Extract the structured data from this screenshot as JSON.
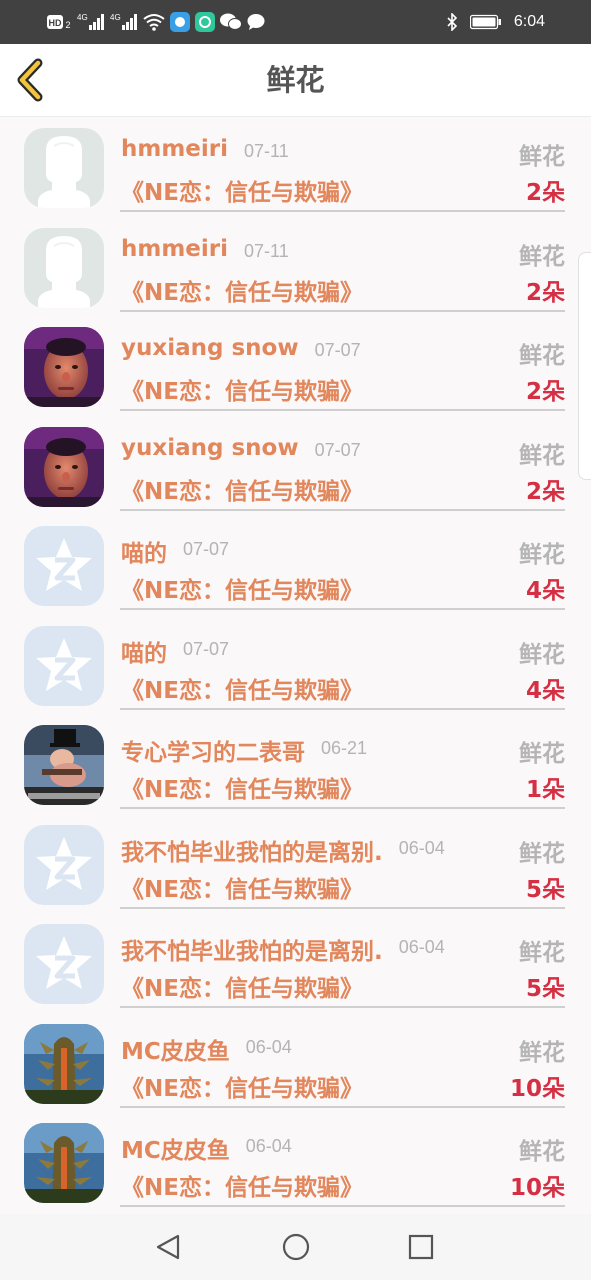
{
  "status_bar": {
    "time": "6:04",
    "left_icons": [
      "hd-icon",
      "signal-4g-icon",
      "signal-4g-icon",
      "wifi-icon",
      "app-icon",
      "app-icon",
      "wechat-icon",
      "chat-bubble-icon"
    ],
    "right_icons": [
      "bluetooth-icon",
      "battery-icon"
    ]
  },
  "header": {
    "title": "鲜花",
    "back_icon": "chevron-left-icon"
  },
  "rows": [
    {
      "name": "hmmeiri",
      "date": "07-11",
      "gift_label": "鲜花",
      "book": "《NE恋：信任与欺骗》",
      "count": "2朵",
      "avatar": "default-silhouette"
    },
    {
      "name": "hmmeiri",
      "date": "07-11",
      "gift_label": "鲜花",
      "book": "《NE恋：信任与欺骗》",
      "count": "2朵",
      "avatar": "default-silhouette"
    },
    {
      "name": "yuxiang snow",
      "date": "07-07",
      "gift_label": "鲜花",
      "book": "《NE恋：信任与欺骗》",
      "count": "2朵",
      "avatar": "face-photo"
    },
    {
      "name": "yuxiang snow",
      "date": "07-07",
      "gift_label": "鲜花",
      "book": "《NE恋：信任与欺骗》",
      "count": "2朵",
      "avatar": "face-photo"
    },
    {
      "name": "喵的",
      "date": "07-07",
      "gift_label": "鲜花",
      "book": "《NE恋：信任与欺骗》",
      "count": "4朵",
      "avatar": "qq-star"
    },
    {
      "name": "喵的",
      "date": "07-07",
      "gift_label": "鲜花",
      "book": "《NE恋：信任与欺骗》",
      "count": "4朵",
      "avatar": "qq-star"
    },
    {
      "name": "专心学习的二表哥",
      "date": "06-21",
      "gift_label": "鲜花",
      "book": "《NE恋：信任与欺骗》",
      "count": "1朵",
      "avatar": "cartoon-photo"
    },
    {
      "name": "我不怕毕业我怕的是离别.",
      "date": "06-04",
      "gift_label": "鲜花",
      "book": "《NE恋：信任与欺骗》",
      "count": "5朵",
      "avatar": "qq-star"
    },
    {
      "name": "我不怕毕业我怕的是离别.",
      "date": "06-04",
      "gift_label": "鲜花",
      "book": "《NE恋：信任与欺骗》",
      "count": "5朵",
      "avatar": "qq-star"
    },
    {
      "name": "MC皮皮鱼",
      "date": "06-04",
      "gift_label": "鲜花",
      "book": "《NE恋：信任与欺骗》",
      "count": "10朵",
      "avatar": "dragon-photo"
    },
    {
      "name": "MC皮皮鱼",
      "date": "06-04",
      "gift_label": "鲜花",
      "book": "《NE恋：信任与欺骗》",
      "count": "10朵",
      "avatar": "dragon-photo"
    }
  ],
  "nav_bar": {
    "icons": [
      "back-triangle-icon",
      "home-circle-icon",
      "recents-square-icon"
    ]
  },
  "colors": {
    "accent": "#e2865c",
    "count": "#d52f43",
    "muted": "#b5b5b5",
    "status_bar": "#414141"
  }
}
